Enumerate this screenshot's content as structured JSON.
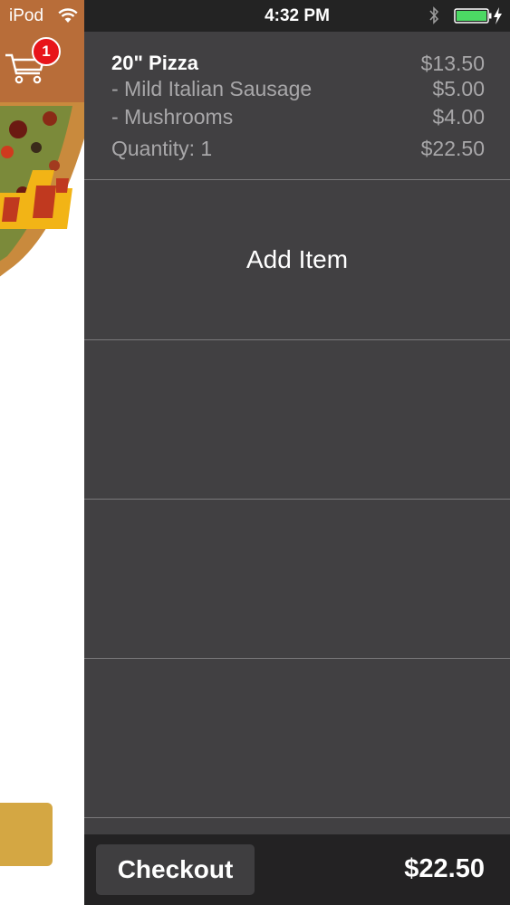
{
  "status_bar": {
    "carrier": "iPod",
    "time": "4:32 PM",
    "icons": [
      "wifi-icon",
      "bluetooth-icon",
      "battery-icon",
      "charging-icon"
    ]
  },
  "cart_header": {
    "badge_count": "1",
    "icon": "cart-icon"
  },
  "order": {
    "items": [
      {
        "name": "20\" Pizza",
        "price": "$13.50",
        "toppings": [
          {
            "label": " - Mild Italian Sausage",
            "price": "$5.00"
          },
          {
            "label": " - Mushrooms",
            "price": "$4.00"
          }
        ],
        "quantity_label": "Quantity: 1",
        "line_total": "$22.50"
      }
    ],
    "add_item_label": "Add Item"
  },
  "footer": {
    "checkout_label": "Checkout",
    "total": "$22.50"
  },
  "colors": {
    "header_brown": "#b86d39",
    "panel_gray": "#414042",
    "bar_dark": "#232223",
    "badge_red": "#e8141a",
    "side_button_gold": "#d4a743"
  }
}
